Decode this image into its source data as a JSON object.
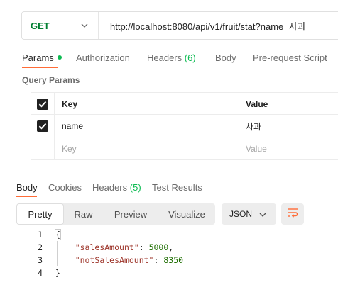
{
  "request": {
    "method": "GET",
    "url": "http://localhost:8080/api/v1/fruit/stat?name=사과"
  },
  "request_tabs": [
    {
      "label": "Params",
      "active": true,
      "has_dot": true
    },
    {
      "label": "Authorization"
    },
    {
      "label": "Headers",
      "count": "(6)"
    },
    {
      "label": "Body"
    },
    {
      "label": "Pre-request Script"
    }
  ],
  "query_params": {
    "title": "Query Params",
    "headers": {
      "key": "Key",
      "value": "Value"
    },
    "rows": [
      {
        "checked": true,
        "key": "name",
        "value": "사과"
      }
    ],
    "placeholder": {
      "key": "Key",
      "value": "Value"
    }
  },
  "response_tabs": [
    {
      "label": "Body",
      "active": true
    },
    {
      "label": "Cookies"
    },
    {
      "label": "Headers",
      "count": "(5)"
    },
    {
      "label": "Test Results"
    }
  ],
  "view_options": [
    "Pretty",
    "Raw",
    "Preview",
    "Visualize"
  ],
  "view_selected": "Pretty",
  "format": "JSON",
  "code_lines": [
    {
      "n": "1",
      "text": "{"
    },
    {
      "n": "2",
      "key": "\"salesAmount\"",
      "value": "5000",
      "trail": ","
    },
    {
      "n": "3",
      "key": "\"notSalesAmount\"",
      "value": "8350",
      "trail": ""
    },
    {
      "n": "4",
      "text": "}"
    }
  ],
  "colors": {
    "accent": "#ff6c37",
    "method_get": "#007f31",
    "active_dot": "#0cbb52"
  },
  "icons": [
    "chevron-down-icon",
    "checkbox-checked-icon",
    "wrap-lines-icon"
  ]
}
